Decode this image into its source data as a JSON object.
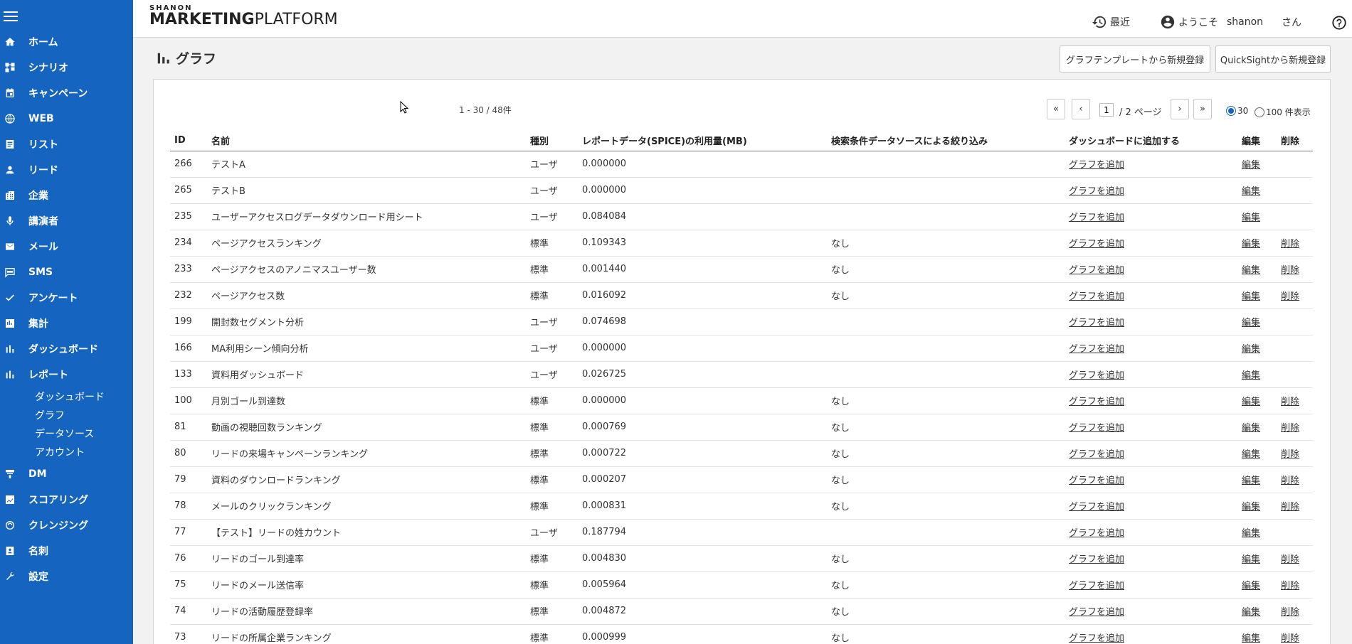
{
  "sidebar": {
    "items": [
      {
        "label": "ホーム",
        "icon": "home-icon"
      },
      {
        "label": "シナリオ",
        "icon": "scenario-icon"
      },
      {
        "label": "キャンペーン",
        "icon": "calendar-icon"
      },
      {
        "label": "WEB",
        "icon": "globe-icon"
      },
      {
        "label": "リスト",
        "icon": "list-icon"
      },
      {
        "label": "リード",
        "icon": "person-icon"
      },
      {
        "label": "企業",
        "icon": "building-icon"
      },
      {
        "label": "講演者",
        "icon": "mic-icon"
      },
      {
        "label": "メール",
        "icon": "mail-icon"
      },
      {
        "label": "SMS",
        "icon": "sms-icon"
      },
      {
        "label": "アンケート",
        "icon": "check-icon"
      },
      {
        "label": "集計",
        "icon": "tally-icon"
      },
      {
        "label": "ダッシュボード",
        "icon": "bar-chart-icon"
      },
      {
        "label": "レポート",
        "icon": "report-chart-icon"
      }
    ],
    "report_sub": [
      "ダッシュボード",
      "グラフ",
      "データソース",
      "アカウント"
    ],
    "items_after": [
      {
        "label": "DM",
        "icon": "dm-icon"
      },
      {
        "label": "スコアリング",
        "icon": "scoring-icon"
      },
      {
        "label": "クレンジング",
        "icon": "cleansing-icon"
      },
      {
        "label": "名刺",
        "icon": "business-card-icon"
      },
      {
        "label": "設定",
        "icon": "wrench-icon"
      }
    ]
  },
  "header": {
    "logo_small": "SHANON",
    "logo_big_bold": "MARKETING",
    "logo_big_light": "PLATFORM",
    "recent": "最近",
    "welcome": "ようこそ",
    "user": "shanon",
    "honorific": "さん"
  },
  "page": {
    "title": "グラフ",
    "btn_template": "グラフテンプレートから新規登録",
    "btn_quicksight": "QuickSightから新規登録",
    "count": "1 - 30 / 48件",
    "page_current": "1",
    "page_total": "/ 2 ページ",
    "per_page_30": "30",
    "per_page_100": "100 件表示",
    "nav_first": "«",
    "nav_prev": "‹",
    "nav_next": "›",
    "nav_last": "»"
  },
  "table": {
    "headers": {
      "id": "ID",
      "name": "名前",
      "type": "種別",
      "usage": "レポートデータ(SPICE)の利用量(MB)",
      "filter": "検索条件データソースによる絞り込み",
      "dashboard": "ダッシュボードに追加する",
      "edit": "編集",
      "delete": "削除"
    },
    "rows": [
      {
        "id": "266",
        "name": "テストA",
        "type": "ユーザ",
        "usage": "0.000000",
        "filter": "",
        "dash": "グラフを追加",
        "edit": "編集",
        "del": ""
      },
      {
        "id": "265",
        "name": "テストB",
        "type": "ユーザ",
        "usage": "0.000000",
        "filter": "",
        "dash": "グラフを追加",
        "edit": "編集",
        "del": ""
      },
      {
        "id": "235",
        "name": "ユーザーアクセスログデータダウンロード用シート",
        "type": "ユーザ",
        "usage": "0.084084",
        "filter": "",
        "dash": "グラフを追加",
        "edit": "編集",
        "del": ""
      },
      {
        "id": "234",
        "name": "ページアクセスランキング",
        "type": "標準",
        "usage": "0.109343",
        "filter": "なし",
        "dash": "グラフを追加",
        "edit": "編集",
        "del": "削除"
      },
      {
        "id": "233",
        "name": "ページアクセスのアノニマスユーザー数",
        "type": "標準",
        "usage": "0.001440",
        "filter": "なし",
        "dash": "グラフを追加",
        "edit": "編集",
        "del": "削除"
      },
      {
        "id": "232",
        "name": "ページアクセス数",
        "type": "標準",
        "usage": "0.016092",
        "filter": "なし",
        "dash": "グラフを追加",
        "edit": "編集",
        "del": "削除"
      },
      {
        "id": "199",
        "name": "開封数セグメント分析",
        "type": "ユーザ",
        "usage": "0.074698",
        "filter": "",
        "dash": "グラフを追加",
        "edit": "編集",
        "del": ""
      },
      {
        "id": "166",
        "name": "MA利用シーン傾向分析",
        "type": "ユーザ",
        "usage": "0.000000",
        "filter": "",
        "dash": "グラフを追加",
        "edit": "編集",
        "del": ""
      },
      {
        "id": "133",
        "name": "資料用ダッシュボード",
        "type": "ユーザ",
        "usage": "0.026725",
        "filter": "",
        "dash": "グラフを追加",
        "edit": "編集",
        "del": ""
      },
      {
        "id": "100",
        "name": "月別ゴール到達数",
        "type": "標準",
        "usage": "0.000000",
        "filter": "なし",
        "dash": "グラフを追加",
        "edit": "編集",
        "del": "削除"
      },
      {
        "id": "81",
        "name": "動画の視聴回数ランキング",
        "type": "標準",
        "usage": "0.000769",
        "filter": "なし",
        "dash": "グラフを追加",
        "edit": "編集",
        "del": "削除"
      },
      {
        "id": "80",
        "name": "リードの来場キャンペーンランキング",
        "type": "標準",
        "usage": "0.000722",
        "filter": "なし",
        "dash": "グラフを追加",
        "edit": "編集",
        "del": "削除"
      },
      {
        "id": "79",
        "name": "資料のダウンロードランキング",
        "type": "標準",
        "usage": "0.000207",
        "filter": "なし",
        "dash": "グラフを追加",
        "edit": "編集",
        "del": "削除"
      },
      {
        "id": "78",
        "name": "メールのクリックランキング",
        "type": "標準",
        "usage": "0.000831",
        "filter": "なし",
        "dash": "グラフを追加",
        "edit": "編集",
        "del": "削除"
      },
      {
        "id": "77",
        "name": "【テスト】リードの姓カウント",
        "type": "ユーザ",
        "usage": "0.187794",
        "filter": "",
        "dash": "グラフを追加",
        "edit": "編集",
        "del": ""
      },
      {
        "id": "76",
        "name": "リードのゴール到達率",
        "type": "標準",
        "usage": "0.004830",
        "filter": "なし",
        "dash": "グラフを追加",
        "edit": "編集",
        "del": "削除"
      },
      {
        "id": "75",
        "name": "リードのメール送信率",
        "type": "標準",
        "usage": "0.005964",
        "filter": "なし",
        "dash": "グラフを追加",
        "edit": "編集",
        "del": "削除"
      },
      {
        "id": "74",
        "name": "リードの活動履歴登録率",
        "type": "標準",
        "usage": "0.004872",
        "filter": "なし",
        "dash": "グラフを追加",
        "edit": "編集",
        "del": "削除"
      },
      {
        "id": "73",
        "name": "リードの所属企業ランキング",
        "type": "標準",
        "usage": "0.000999",
        "filter": "なし",
        "dash": "グラフを追加",
        "edit": "編集",
        "del": "削除"
      }
    ]
  },
  "colors": {
    "sidebar": "#1565c0",
    "accent": "#1565c0"
  }
}
